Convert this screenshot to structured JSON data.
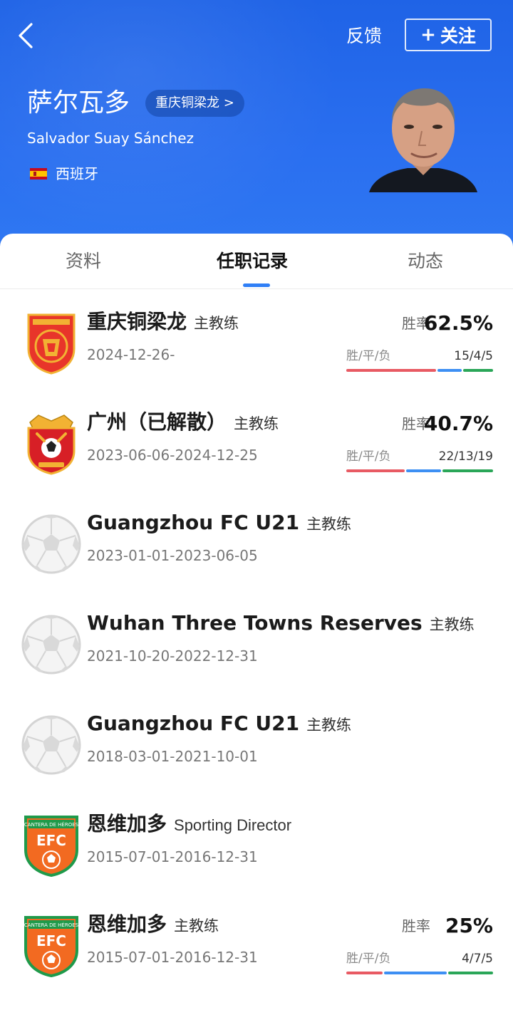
{
  "header": {
    "feedback_label": "反馈",
    "follow_plus": "+",
    "follow_label": "关注",
    "name_cn": "萨尔瓦多",
    "team_chip": "重庆铜梁龙 >",
    "name_en": "Salvador Suay Sánchez",
    "nationality": "西班牙"
  },
  "tabs": [
    {
      "label": "资料"
    },
    {
      "label": "任职记录"
    },
    {
      "label": "动态"
    }
  ],
  "career": [
    {
      "club": "重庆铜梁龙",
      "role": "主教练",
      "dates": "2024-12-26-",
      "logo": "chongqing-tongliangloong-logo",
      "win_rate_label": "胜率",
      "win_rate": "62.5%",
      "wdl_label": "胜/平/负",
      "wdl": "15/4/5",
      "w": 15,
      "d": 4,
      "l": 5
    },
    {
      "club": "广州（已解散）",
      "role": "主教练",
      "dates": "2023-06-06-2024-12-25",
      "logo": "guangzhou-fc-logo",
      "win_rate_label": "胜率",
      "win_rate": "40.7%",
      "wdl_label": "胜/平/负",
      "wdl": "22/13/19",
      "w": 22,
      "d": 13,
      "l": 19
    },
    {
      "club": "Guangzhou FC U21",
      "role": "主教练",
      "dates": "2023-01-01-2023-06-05",
      "logo": "soccer-ball-placeholder"
    },
    {
      "club": "Wuhan Three Towns Reserves",
      "role": "主教练",
      "dates": "2021-10-20-2022-12-31",
      "logo": "soccer-ball-placeholder"
    },
    {
      "club": "Guangzhou FC U21",
      "role": "主教练",
      "dates": "2018-03-01-2021-10-01",
      "logo": "soccer-ball-placeholder"
    },
    {
      "club": "恩维加多",
      "role": "Sporting Director",
      "dates": "2015-07-01-2016-12-31",
      "logo": "envigado-fc-logo"
    },
    {
      "club": "恩维加多",
      "role": "主教练",
      "dates": "2015-07-01-2016-12-31",
      "logo": "envigado-fc-logo",
      "win_rate_label": "胜率",
      "win_rate": "25%",
      "wdl_label": "胜/平/负",
      "wdl": "4/7/5",
      "w": 4,
      "d": 7,
      "l": 5
    }
  ],
  "logo_text": {
    "efc": "EFC",
    "cantera": "CANTERA DE HÉROES"
  },
  "colors": {
    "header_blue": "#2a6ff0",
    "win": "#e85a63",
    "draw": "#3d8ff3",
    "loss": "#2aa658",
    "tab_indicator": "#2f7ff6"
  }
}
